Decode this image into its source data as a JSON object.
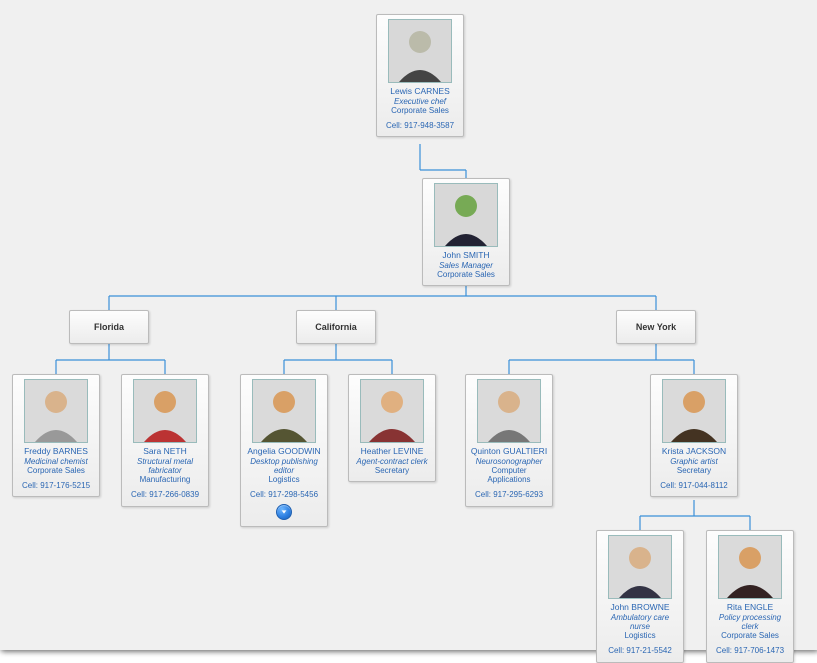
{
  "chart_data": {
    "type": "org-chart",
    "root": {
      "name": "Lewis CARNES",
      "role": "Executive chef",
      "department": "Corporate Sales",
      "cell": "Cell: 917-948-3587",
      "children": [
        {
          "name": "John SMITH",
          "role": "Sales Manager",
          "department": "Corporate Sales",
          "children": [
            {
              "group": "Florida",
              "children": [
                {
                  "name": "Freddy BARNES",
                  "role": "Medicinal chemist",
                  "department": "Corporate Sales",
                  "cell": "Cell: 917-176-5215"
                },
                {
                  "name": "Sara NETH",
                  "role": "Structural metal fabricator",
                  "department": "Manufacturing",
                  "cell": "Cell: 917-266-0839"
                }
              ]
            },
            {
              "group": "California",
              "children": [
                {
                  "name": "Angelia GOODWIN",
                  "role": "Desktop publishing editor",
                  "department": "Logistics",
                  "cell": "Cell: 917-298-5456",
                  "has_more": true
                },
                {
                  "name": "Heather LEVINE",
                  "role": "Agent-contract clerk",
                  "department": "Secretary"
                }
              ]
            },
            {
              "group": "New York",
              "children": [
                {
                  "name": "Quinton GUALTIERI",
                  "role": "Neurosonographer",
                  "department": "Computer Applications",
                  "cell": "Cell: 917-295-6293"
                },
                {
                  "name": "Krista JACKSON",
                  "role": "Graphic artist",
                  "department": "Secretary",
                  "cell": "Cell: 917-044-8112",
                  "children": [
                    {
                      "name": "John BROWNE",
                      "role": "Ambulatory care nurse",
                      "department": "Logistics",
                      "cell": "Cell: 917-21-5542"
                    },
                    {
                      "name": "Rita ENGLE",
                      "role": "Policy processing clerk",
                      "department": "Corporate Sales",
                      "cell": "Cell: 917-706-1473"
                    }
                  ]
                }
              ]
            }
          ]
        }
      ]
    }
  },
  "lewis": {
    "name": "Lewis CARNES",
    "role": "Executive chef",
    "dept": "Corporate Sales",
    "cell": "Cell: 917-948-3587"
  },
  "john_s": {
    "name": "John SMITH",
    "role": "Sales Manager",
    "dept": "Corporate Sales"
  },
  "groups": {
    "fl": "Florida",
    "ca": "California",
    "ny": "New York"
  },
  "freddy": {
    "name": "Freddy BARNES",
    "role": "Medicinal chemist",
    "dept": "Corporate Sales",
    "cell": "Cell: 917-176-5215"
  },
  "sara": {
    "name": "Sara NETH",
    "role": "Structural metal fabricator",
    "dept": "Manufacturing",
    "cell": "Cell: 917-266-0839"
  },
  "angelia": {
    "name": "Angelia GOODWIN",
    "role": "Desktop publishing editor",
    "dept": "Logistics",
    "cell": "Cell: 917-298-5456"
  },
  "heather": {
    "name": "Heather LEVINE",
    "role": "Agent-contract clerk",
    "dept": "Secretary"
  },
  "quinton": {
    "name": "Quinton GUALTIERI",
    "role": "Neurosonographer",
    "dept": "Computer Applications",
    "cell": "Cell: 917-295-6293"
  },
  "krista": {
    "name": "Krista JACKSON",
    "role": "Graphic artist",
    "dept": "Secretary",
    "cell": "Cell: 917-044-8112"
  },
  "john_b": {
    "name": "John BROWNE",
    "role": "Ambulatory care nurse",
    "dept": "Logistics",
    "cell": "Cell: 917-21-5542"
  },
  "rita": {
    "name": "Rita ENGLE",
    "role": "Policy processing clerk",
    "dept": "Corporate Sales",
    "cell": "Cell: 917-706-1473"
  }
}
